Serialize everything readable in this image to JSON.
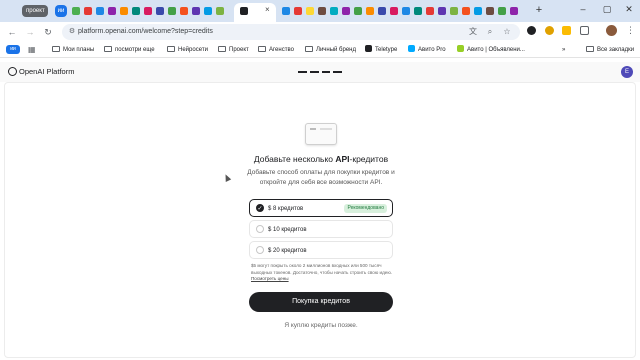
{
  "browser": {
    "tab_groups": [
      "проект",
      "ии"
    ],
    "url": "platform.openai.com/welcome?step=credits",
    "bookmarks": [
      "Мои планы",
      "посмотри еще",
      "Нейросети",
      "Проект",
      "Агенство",
      "Личный бренд",
      "Teletype",
      "Авито Pro",
      "Авито | Объявлени...",
      "Все закладки"
    ],
    "bookmark_chip": "ии",
    "more_label": "»",
    "tab_close": "×",
    "new_tab": "+"
  },
  "header": {
    "brand": "OpenAI Platform",
    "user_initial": "E"
  },
  "main": {
    "title_prefix": "Добавьте несколько ",
    "title_bold": "API",
    "title_suffix": "-кредитов",
    "subtitle": "Добавьте способ оплаты для покупки кредитов и откройте для себя все возможности API.",
    "options": [
      {
        "label": "$ 8 кредитов",
        "badge": "Рекомендовано",
        "selected": true
      },
      {
        "label": "$ 10 кредитов",
        "selected": false
      },
      {
        "label": "$ 20 кредитов",
        "selected": false
      }
    ],
    "note_text": "$5 могут покрыть около 2 миллионов входных или 500 тысяч выходных токенов. Достаточно, чтобы начать строить свою идею.",
    "note_link": "Посмотреть цены",
    "buy_button": "Покупка кредитов",
    "later_link": "Я куплю кредиты позже."
  },
  "colors": {
    "tabstrip": "#d7e3f3",
    "accent": "#1a73e8",
    "button_dark": "#202124",
    "badge_bg": "#d8f0dd",
    "badge_text": "#1f7a3d"
  }
}
